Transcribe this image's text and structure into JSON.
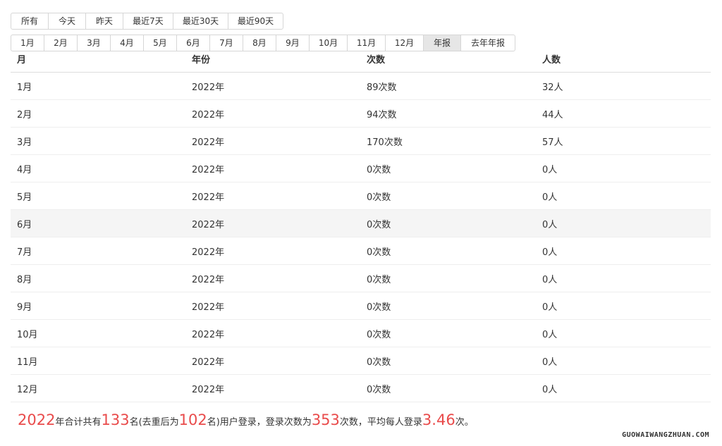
{
  "range_buttons": [
    "所有",
    "今天",
    "昨天",
    "最近7天",
    "最近30天",
    "最近90天"
  ],
  "month_buttons": [
    "1月",
    "2月",
    "3月",
    "4月",
    "5月",
    "6月",
    "7月",
    "8月",
    "9月",
    "10月",
    "11月",
    "12月",
    "年报",
    "去年年报"
  ],
  "active_month_button": "年报",
  "table": {
    "headers": [
      "月",
      "年份",
      "次数",
      "人数"
    ],
    "rows": [
      [
        "1月",
        "2022年",
        "89次数",
        "32人"
      ],
      [
        "2月",
        "2022年",
        "94次数",
        "44人"
      ],
      [
        "3月",
        "2022年",
        "170次数",
        "57人"
      ],
      [
        "4月",
        "2022年",
        "0次数",
        "0人"
      ],
      [
        "5月",
        "2022年",
        "0次数",
        "0人"
      ],
      [
        "6月",
        "2022年",
        "0次数",
        "0人"
      ],
      [
        "7月",
        "2022年",
        "0次数",
        "0人"
      ],
      [
        "8月",
        "2022年",
        "0次数",
        "0人"
      ],
      [
        "9月",
        "2022年",
        "0次数",
        "0人"
      ],
      [
        "10月",
        "2022年",
        "0次数",
        "0人"
      ],
      [
        "11月",
        "2022年",
        "0次数",
        "0人"
      ],
      [
        "12月",
        "2022年",
        "0次数",
        "0人"
      ]
    ]
  },
  "summary": {
    "year": "2022",
    "t1": "年合计共有",
    "users": "133",
    "t2": "名(去重后为",
    "unique_users": "102",
    "t3": "名)用户登录，登录次数为",
    "logins": "353",
    "t4": "次数，平均每人登录",
    "avg": "3.46",
    "t5": "次。"
  },
  "watermark": "GUOWAIWANGZHUAN.COM",
  "colors": {
    "highlight": "#e94b4b",
    "active_button": "#e6e6e6",
    "hover_row": "#f5f5f5"
  }
}
